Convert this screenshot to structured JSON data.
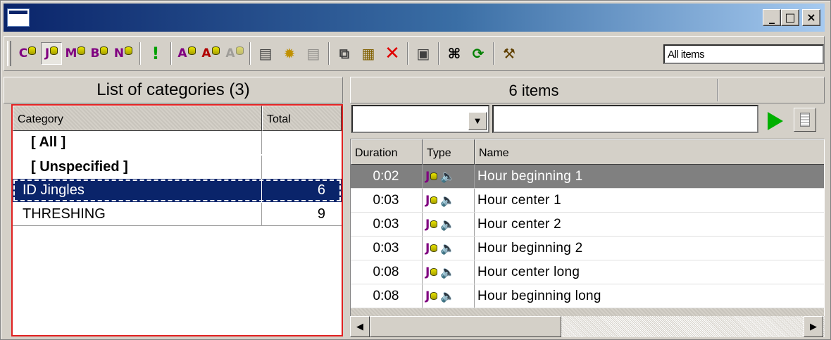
{
  "window": {
    "minimize": "_",
    "maximize": "□",
    "close": "×"
  },
  "toolbar": {
    "cat_buttons": [
      {
        "letter": "C",
        "icon": "category-c-icon"
      },
      {
        "letter": "J",
        "icon": "category-j-icon"
      },
      {
        "letter": "M",
        "icon": "category-m-icon"
      },
      {
        "letter": "B",
        "icon": "category-b-icon"
      },
      {
        "letter": "N",
        "icon": "category-n-icon"
      }
    ],
    "alert_glyph": "!",
    "add_a_letter": "A",
    "filter_value": "All items"
  },
  "categories": {
    "title": "List of categories (3)",
    "col_category": "Category",
    "col_total": "Total",
    "rows": [
      {
        "name": "[ All ]",
        "total": ""
      },
      {
        "name": "[ Unspecified ]",
        "total": ""
      },
      {
        "name": "ID Jingles",
        "total": "6"
      },
      {
        "name": "THRESHING",
        "total": "9"
      }
    ]
  },
  "items": {
    "title": "6 items",
    "col_duration": "Duration",
    "col_type": "Type",
    "col_name": "Name",
    "type_letter": "J",
    "speaker_glyph": "🔈",
    "rows": [
      {
        "duration": "0:02",
        "name": "Hour beginning 1"
      },
      {
        "duration": "0:03",
        "name": "Hour center 1"
      },
      {
        "duration": "0:03",
        "name": "Hour center 2"
      },
      {
        "duration": "0:03",
        "name": "Hour beginning 2"
      },
      {
        "duration": "0:08",
        "name": "Hour center long"
      },
      {
        "duration": "0:08",
        "name": "Hour beginning long"
      }
    ]
  },
  "scroll": {
    "left_arrow": "◀",
    "right_arrow": "▶",
    "combo_arrow": "▼"
  },
  "colors": {
    "title_bar": "#0a246a",
    "selection": "#0a246a",
    "panel_border": "#e02020",
    "play": "#00b000",
    "letter": "#800080"
  }
}
